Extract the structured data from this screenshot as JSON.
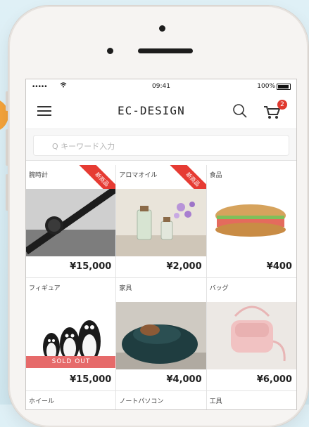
{
  "status_bar": {
    "signal": "•••••",
    "wifi": "",
    "time": "09:41",
    "battery_pct": "100%"
  },
  "header": {
    "logo_text": "EC-DESIGN",
    "cart_count": "2"
  },
  "search": {
    "placeholder": "Q キーワード入力"
  },
  "products": {
    "row1": [
      {
        "name": "腕時計",
        "price": "¥15,000",
        "badge": "新商品"
      },
      {
        "name": "アロマオイル",
        "price": "¥2,000",
        "badge": "新商品"
      },
      {
        "name": "食品",
        "price": "¥400"
      }
    ],
    "row2": [
      {
        "name": "フィギュア",
        "price": "¥15,000",
        "status": "SOLD OUT"
      },
      {
        "name": "家具",
        "price": "¥4,000"
      },
      {
        "name": "バッグ",
        "price": "¥6,000"
      }
    ],
    "row3": [
      {
        "name": "ホイール"
      },
      {
        "name": "ノートパソコン"
      },
      {
        "name": "工具"
      }
    ]
  }
}
